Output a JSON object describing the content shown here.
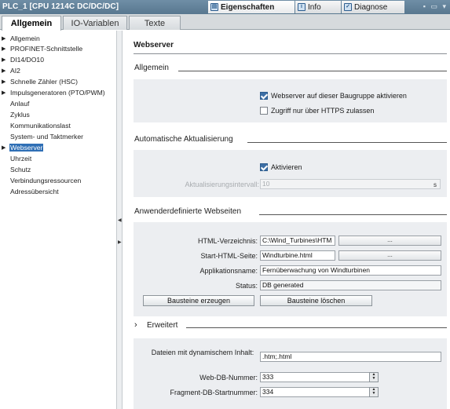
{
  "window": {
    "title": "PLC_1 [CPU 1214C DC/DC/DC]",
    "panel_tabs": [
      {
        "label": "Eigenschaften",
        "icon": "properties-icon"
      },
      {
        "label": "Info",
        "icon": "info-icon"
      },
      {
        "label": "Diagnose",
        "icon": "diagnose-icon"
      }
    ],
    "controls": "▪ ▭ ▾"
  },
  "tabs": [
    "Allgemein",
    "IO-Variablen",
    "Texte"
  ],
  "nav": {
    "items": [
      {
        "label": "Allgemein",
        "expandable": true
      },
      {
        "label": "PROFINET-Schnittstelle",
        "expandable": true
      },
      {
        "label": "DI14/DO10",
        "expandable": true
      },
      {
        "label": "AI2",
        "expandable": true
      },
      {
        "label": "Schnelle Zähler (HSC)",
        "expandable": true
      },
      {
        "label": "Impulsgeneratoren (PTO/PWM)",
        "expandable": true
      },
      {
        "label": "Anlauf",
        "expandable": false
      },
      {
        "label": "Zyklus",
        "expandable": false
      },
      {
        "label": "Kommunikationslast",
        "expandable": false
      },
      {
        "label": "System- und Taktmerker",
        "expandable": false
      },
      {
        "label": "Webserver",
        "expandable": true,
        "selected": true
      },
      {
        "label": "Uhrzeit",
        "expandable": false
      },
      {
        "label": "Schutz",
        "expandable": false
      },
      {
        "label": "Verbindungsressourcen",
        "expandable": false
      },
      {
        "label": "Adressübersicht",
        "expandable": false
      }
    ]
  },
  "main": {
    "title": "Webserver",
    "general": {
      "heading": "Allgemein",
      "enable_label": "Webserver auf dieser Baugruppe aktivieren",
      "enable_checked": true,
      "https_label": "Zugriff nur über HTTPS zulassen",
      "https_checked": false
    },
    "auto_update": {
      "heading": "Automatische Aktualisierung",
      "activate_label": "Aktivieren",
      "activate_checked": true,
      "interval_label": "Aktualisierungsintervall:",
      "interval_value": "10",
      "interval_unit": "s"
    },
    "user_pages": {
      "heading": "Anwenderdefinierte Webseiten",
      "html_dir_label": "HTML-Verzeichnis:",
      "html_dir_value": "C:\\Wind_Turbines\\HTM",
      "start_page_label": "Start-HTML-Seite:",
      "start_page_value": "Windturbine.html",
      "browse_label": "...",
      "app_name_label": "Applikationsname:",
      "app_name_value": "Fernüberwachung von Windturbinen",
      "status_label": "Status:",
      "status_value": "DB generated",
      "generate_button": "Bausteine erzeugen",
      "delete_button": "Bausteine löschen"
    },
    "advanced": {
      "heading": "Erweitert",
      "expander": "›",
      "dyn_files_label": "Dateien mit dynamischem Inhalt:",
      "dyn_files_value": ".htm;.html",
      "web_db_label": "Web-DB-Nummer:",
      "web_db_value": "333",
      "frag_db_label": "Fragment-DB-Startnummer:",
      "frag_db_value": "334"
    }
  }
}
